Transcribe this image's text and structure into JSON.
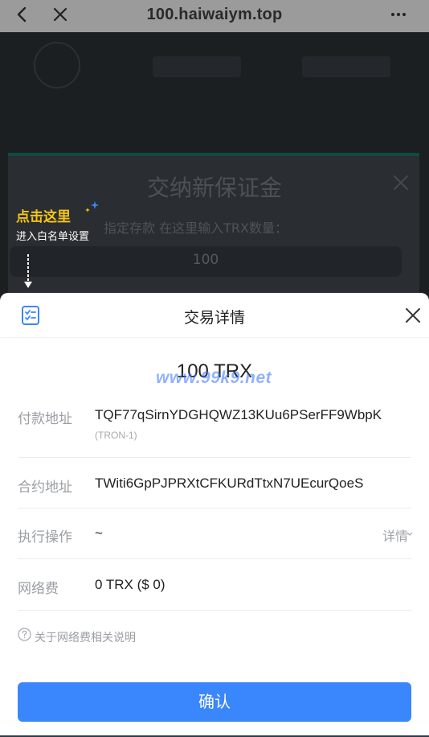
{
  "browser": {
    "url_title": "100.haiwaiym.top"
  },
  "background_page": {
    "dialog_title": "交纳新保证金",
    "deposit_label": "指定存款 在这里输入TRX数量：",
    "deposit_value": "100"
  },
  "hint": {
    "title": "点击这里",
    "subtitle": "进入白名单设置"
  },
  "sheet": {
    "title": "交易详情",
    "amount": "100 TRX",
    "watermark": "www.99k9.net",
    "rows": [
      {
        "label": "付款地址",
        "value": "TQF77qSirnYDGHQWZ13KUu6PSerFF9WbpK",
        "sub": "(TRON-1)"
      },
      {
        "label": "合约地址",
        "value": "TWiti6GpPJPRXtCFKURdTtxN7UEcurQoeS"
      },
      {
        "label": "执行操作",
        "value": "~",
        "detail": "详情"
      },
      {
        "label": "网络费",
        "value": "0 TRX ($ 0)"
      }
    ],
    "note": "关于网络费相关说明",
    "confirm_label": "确认"
  },
  "colors": {
    "accent": "#3a86fc",
    "hint_yellow": "#f5c518",
    "overlay_bar": "#9b9b9b"
  }
}
